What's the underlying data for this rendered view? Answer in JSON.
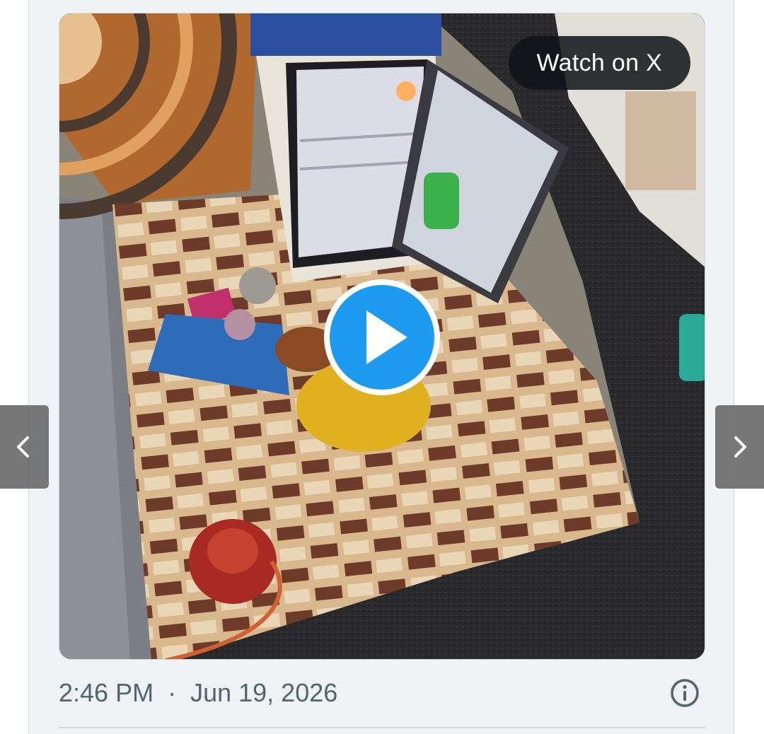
{
  "tweet_embed": {
    "watch_label": "Watch on X",
    "time": "2:46 PM",
    "separator": "·",
    "date": "Jun 19, 2026"
  },
  "icons": {
    "play": "play-icon",
    "prev": "chevron-left-icon",
    "next": "chevron-right-icon",
    "info": "info-icon"
  },
  "colors": {
    "play_accent": "#1d9bf0",
    "meta_text": "#536471",
    "card_background": "#eef2f5"
  }
}
